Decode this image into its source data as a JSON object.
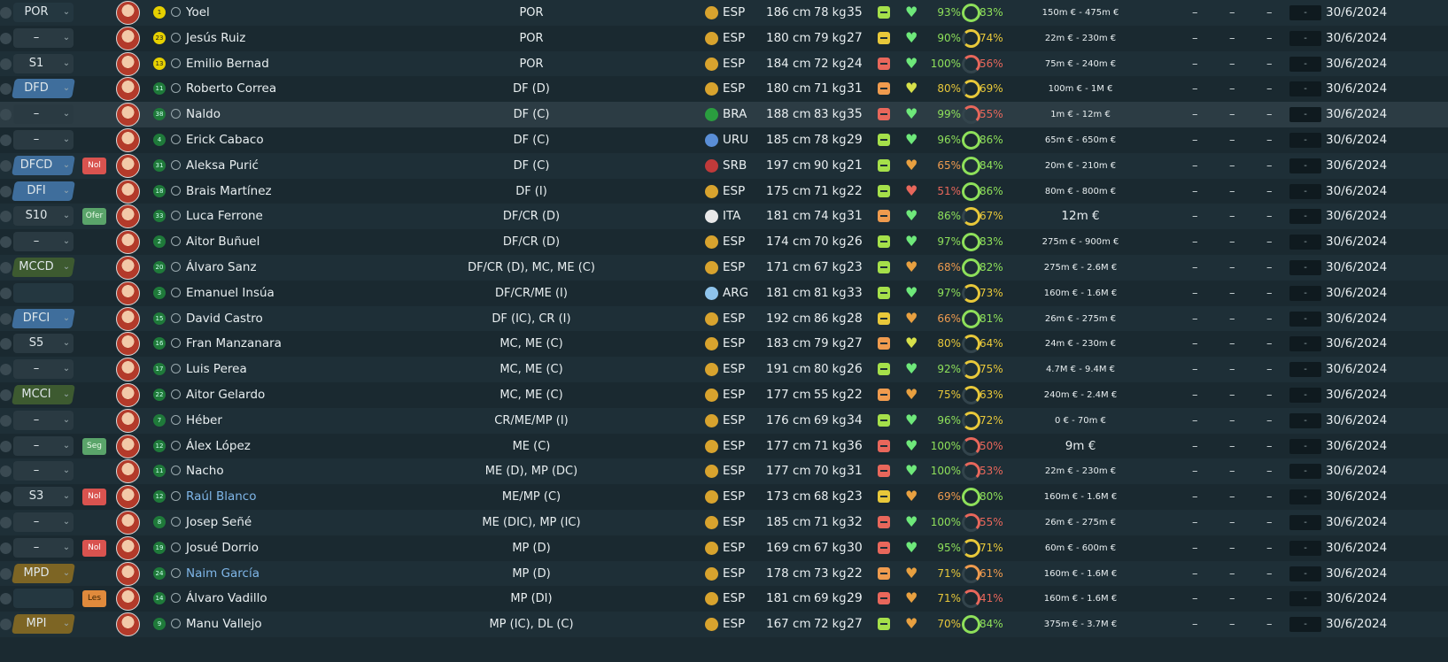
{
  "players": [
    {
      "pos": "POR",
      "posStyle": "none",
      "tag": "",
      "name": "Yoel",
      "link": false,
      "number": "1",
      "gk": true,
      "position": "POR",
      "nation": "ESP",
      "height": "186 cm",
      "weight": "78 kg",
      "age": "35",
      "cond": "green",
      "heart": "green",
      "fitness": "93%",
      "sharp": "83%",
      "sharpClass": "g",
      "value": "150m € - 475m €",
      "bigValue": false,
      "d1": "–",
      "d2": "–",
      "d3": "–",
      "btn": "-",
      "date": "30/6/2024"
    },
    {
      "pos": "–",
      "posStyle": "grey",
      "tag": "",
      "name": "Jesús Ruiz",
      "link": false,
      "number": "23",
      "gk": true,
      "position": "POR",
      "nation": "ESP",
      "height": "180 cm",
      "weight": "79 kg",
      "age": "27",
      "cond": "yellow",
      "heart": "green",
      "fitness": "90%",
      "sharp": "74%",
      "sharpClass": "y",
      "value": "22m € - 230m €",
      "bigValue": false,
      "d1": "–",
      "d2": "–",
      "d3": "–",
      "btn": "-",
      "date": "30/6/2024"
    },
    {
      "pos": "S1",
      "posStyle": "grey",
      "tag": "",
      "name": "Emilio Bernad",
      "link": false,
      "number": "13",
      "gk": true,
      "position": "POR",
      "nation": "ESP",
      "height": "184 cm",
      "weight": "72 kg",
      "age": "24",
      "cond": "red",
      "heart": "green",
      "fitness": "100%",
      "sharp": "56%",
      "sharpClass": "r",
      "value": "75m € - 240m €",
      "bigValue": false,
      "d1": "–",
      "d2": "–",
      "d3": "–",
      "btn": "-",
      "date": "30/6/2024"
    },
    {
      "pos": "DFD",
      "posStyle": "blue",
      "tag": "",
      "name": "Roberto Correa",
      "link": false,
      "number": "11",
      "gk": false,
      "position": "DF (D)",
      "nation": "ESP",
      "height": "180 cm",
      "weight": "71 kg",
      "age": "31",
      "cond": "orange",
      "heart": "yellow",
      "fitness": "80%",
      "sharp": "69%",
      "sharpClass": "y",
      "value": "100m € - 1M €",
      "bigValue": false,
      "d1": "–",
      "d2": "–",
      "d3": "–",
      "btn": "-",
      "date": "30/6/2024"
    },
    {
      "pos": "–",
      "posStyle": "grey",
      "tag": "",
      "name": "Naldo",
      "link": false,
      "number": "38",
      "gk": false,
      "position": "DF (C)",
      "nation": "BRA",
      "height": "188 cm",
      "weight": "83 kg",
      "age": "35",
      "cond": "red",
      "heart": "green",
      "fitness": "99%",
      "sharp": "55%",
      "sharpClass": "r",
      "value": "1m € - 12m €",
      "bigValue": false,
      "d1": "–",
      "d2": "–",
      "d3": "–",
      "btn": "-",
      "date": "30/6/2024",
      "selected": true
    },
    {
      "pos": "–",
      "posStyle": "grey",
      "tag": "",
      "name": "Erick Cabaco",
      "link": false,
      "number": "4",
      "gk": false,
      "position": "DF (C)",
      "nation": "URU",
      "height": "185 cm",
      "weight": "78 kg",
      "age": "29",
      "cond": "green",
      "heart": "green",
      "fitness": "96%",
      "sharp": "86%",
      "sharpClass": "g",
      "value": "65m € - 650m €",
      "bigValue": false,
      "d1": "–",
      "d2": "–",
      "d3": "–",
      "btn": "-",
      "date": "30/6/2024"
    },
    {
      "pos": "DFCD",
      "posStyle": "blue",
      "tag": "Nol",
      "tagStyle": "red",
      "name": "Aleksa Purić",
      "link": false,
      "number": "31",
      "gk": false,
      "position": "DF (C)",
      "nation": "SRB",
      "height": "197 cm",
      "weight": "90 kg",
      "age": "21",
      "cond": "green",
      "heart": "orange",
      "fitness": "65%",
      "sharp": "84%",
      "sharpClass": "g",
      "value": "20m € - 210m €",
      "bigValue": false,
      "d1": "–",
      "d2": "–",
      "d3": "–",
      "btn": "-",
      "date": "30/6/2024"
    },
    {
      "pos": "DFI",
      "posStyle": "blue",
      "tag": "",
      "name": "Brais Martínez",
      "link": false,
      "number": "18",
      "gk": false,
      "position": "DF (I)",
      "nation": "ESP",
      "height": "175 cm",
      "weight": "71 kg",
      "age": "22",
      "cond": "green",
      "heart": "red",
      "fitness": "51%",
      "sharp": "86%",
      "sharpClass": "g",
      "value": "80m € - 800m €",
      "bigValue": false,
      "d1": "–",
      "d2": "–",
      "d3": "–",
      "btn": "-",
      "date": "30/6/2024"
    },
    {
      "pos": "S10",
      "posStyle": "grey",
      "tag": "Ofer",
      "tagStyle": "green",
      "name": "Luca Ferrone",
      "link": false,
      "number": "33",
      "gk": false,
      "position": "DF/CR (D)",
      "nation": "ITA",
      "height": "181 cm",
      "weight": "74 kg",
      "age": "31",
      "cond": "orange",
      "heart": "green",
      "fitness": "86%",
      "sharp": "67%",
      "sharpClass": "y",
      "value": "12m €",
      "bigValue": true,
      "d1": "–",
      "d2": "–",
      "d3": "–",
      "btn": "-",
      "date": "30/6/2024"
    },
    {
      "pos": "–",
      "posStyle": "grey",
      "tag": "",
      "name": "Aitor Buñuel",
      "link": false,
      "number": "2",
      "gk": false,
      "position": "DF/CR (D)",
      "nation": "ESP",
      "height": "174 cm",
      "weight": "70 kg",
      "age": "26",
      "cond": "green",
      "heart": "green",
      "fitness": "97%",
      "sharp": "83%",
      "sharpClass": "g",
      "value": "275m € - 900m €",
      "bigValue": false,
      "d1": "–",
      "d2": "–",
      "d3": "–",
      "btn": "-",
      "date": "30/6/2024"
    },
    {
      "pos": "MCCD",
      "posStyle": "green",
      "tag": "",
      "name": "Álvaro Sanz",
      "link": false,
      "number": "20",
      "gk": false,
      "position": "DF/CR (D), MC, ME (C)",
      "nation": "ESP",
      "height": "171 cm",
      "weight": "67 kg",
      "age": "23",
      "cond": "green",
      "heart": "orange",
      "fitness": "68%",
      "sharp": "82%",
      "sharpClass": "g",
      "value": "275m € - 2.6M €",
      "bigValue": false,
      "d1": "–",
      "d2": "–",
      "d3": "–",
      "btn": "-",
      "date": "30/6/2024"
    },
    {
      "pos": "",
      "posStyle": "none",
      "tag": "",
      "name": "Emanuel Insúa",
      "link": false,
      "number": "3",
      "gk": false,
      "position": "DF/CR/ME (I)",
      "nation": "ARG",
      "height": "181 cm",
      "weight": "81 kg",
      "age": "33",
      "cond": "green",
      "heart": "green",
      "fitness": "97%",
      "sharp": "73%",
      "sharpClass": "y",
      "value": "160m € - 1.6M €",
      "bigValue": false,
      "d1": "–",
      "d2": "–",
      "d3": "–",
      "btn": "-",
      "date": "30/6/2024"
    },
    {
      "pos": "DFCI",
      "posStyle": "blue",
      "tag": "",
      "name": "David Castro",
      "link": false,
      "number": "15",
      "gk": false,
      "position": "DF (IC), CR (I)",
      "nation": "ESP",
      "height": "192 cm",
      "weight": "86 kg",
      "age": "28",
      "cond": "yellow",
      "heart": "orange",
      "fitness": "66%",
      "sharp": "81%",
      "sharpClass": "g",
      "value": "26m € - 275m €",
      "bigValue": false,
      "d1": "–",
      "d2": "–",
      "d3": "–",
      "btn": "-",
      "date": "30/6/2024"
    },
    {
      "pos": "S5",
      "posStyle": "grey",
      "tag": "",
      "name": "Fran Manzanara",
      "link": false,
      "number": "16",
      "gk": false,
      "position": "MC, ME (C)",
      "nation": "ESP",
      "height": "183 cm",
      "weight": "79 kg",
      "age": "27",
      "cond": "orange",
      "heart": "yellow",
      "fitness": "80%",
      "sharp": "64%",
      "sharpClass": "y",
      "value": "24m € - 230m €",
      "bigValue": false,
      "d1": "–",
      "d2": "–",
      "d3": "–",
      "btn": "-",
      "date": "30/6/2024"
    },
    {
      "pos": "–",
      "posStyle": "grey",
      "tag": "",
      "name": "Luis Perea",
      "link": false,
      "number": "17",
      "gk": false,
      "position": "MC, ME (C)",
      "nation": "ESP",
      "height": "191 cm",
      "weight": "80 kg",
      "age": "26",
      "cond": "green",
      "heart": "green",
      "fitness": "92%",
      "sharp": "75%",
      "sharpClass": "y",
      "value": "4.7M € - 9.4M €",
      "bigValue": false,
      "d1": "–",
      "d2": "–",
      "d3": "–",
      "btn": "-",
      "date": "30/6/2024"
    },
    {
      "pos": "MCCI",
      "posStyle": "green",
      "tag": "",
      "name": "Aitor Gelardo",
      "link": false,
      "number": "22",
      "gk": false,
      "position": "MC, ME (C)",
      "nation": "ESP",
      "height": "177 cm",
      "weight": "55 kg",
      "age": "22",
      "cond": "orange",
      "heart": "orange",
      "fitness": "75%",
      "sharp": "63%",
      "sharpClass": "y",
      "value": "240m € - 2.4M €",
      "bigValue": false,
      "d1": "–",
      "d2": "–",
      "d3": "–",
      "btn": "-",
      "date": "30/6/2024"
    },
    {
      "pos": "–",
      "posStyle": "grey",
      "tag": "",
      "name": "Héber",
      "link": false,
      "number": "7",
      "gk": false,
      "position": "CR/ME/MP (I)",
      "nation": "ESP",
      "height": "176 cm",
      "weight": "69 kg",
      "age": "34",
      "cond": "green",
      "heart": "green",
      "fitness": "96%",
      "sharp": "72%",
      "sharpClass": "y",
      "value": "0 € - 70m €",
      "bigValue": false,
      "d1": "–",
      "d2": "–",
      "d3": "–",
      "btn": "-",
      "date": "30/6/2024"
    },
    {
      "pos": "–",
      "posStyle": "grey",
      "tag": "Seg",
      "tagStyle": "green",
      "name": "Álex López",
      "link": false,
      "number": "12",
      "gk": false,
      "position": "ME (C)",
      "nation": "ESP",
      "height": "177 cm",
      "weight": "71 kg",
      "age": "36",
      "cond": "red",
      "heart": "green",
      "fitness": "100%",
      "sharp": "50%",
      "sharpClass": "r",
      "value": "9m €",
      "bigValue": true,
      "d1": "–",
      "d2": "–",
      "d3": "–",
      "btn": "-",
      "date": "30/6/2024"
    },
    {
      "pos": "–",
      "posStyle": "grey",
      "tag": "",
      "name": "Nacho",
      "link": false,
      "number": "11",
      "gk": false,
      "position": "ME (D), MP (DC)",
      "nation": "ESP",
      "height": "177 cm",
      "weight": "70 kg",
      "age": "31",
      "cond": "red",
      "heart": "green",
      "fitness": "100%",
      "sharp": "53%",
      "sharpClass": "r",
      "value": "22m € - 230m €",
      "bigValue": false,
      "d1": "–",
      "d2": "–",
      "d3": "–",
      "btn": "-",
      "date": "30/6/2024"
    },
    {
      "pos": "S3",
      "posStyle": "grey",
      "tag": "Nol",
      "tagStyle": "red",
      "name": "Raúl Blanco",
      "link": true,
      "number": "12",
      "gk": false,
      "position": "ME/MP (C)",
      "nation": "ESP",
      "height": "173 cm",
      "weight": "68 kg",
      "age": "23",
      "cond": "yellow",
      "heart": "orange",
      "fitness": "69%",
      "sharp": "80%",
      "sharpClass": "g",
      "value": "160m € - 1.6M €",
      "bigValue": false,
      "d1": "–",
      "d2": "–",
      "d3": "–",
      "btn": "-",
      "date": "30/6/2024"
    },
    {
      "pos": "–",
      "posStyle": "grey",
      "tag": "",
      "name": "Josep Señé",
      "link": false,
      "number": "8",
      "gk": false,
      "position": "ME (DIC), MP (IC)",
      "nation": "ESP",
      "height": "185 cm",
      "weight": "71 kg",
      "age": "32",
      "cond": "red",
      "heart": "green",
      "fitness": "100%",
      "sharp": "55%",
      "sharpClass": "r",
      "value": "26m € - 275m €",
      "bigValue": false,
      "d1": "–",
      "d2": "–",
      "d3": "–",
      "btn": "-",
      "date": "30/6/2024"
    },
    {
      "pos": "–",
      "posStyle": "grey",
      "tag": "Nol",
      "tagStyle": "red",
      "name": "Josué Dorrio",
      "link": false,
      "number": "19",
      "gk": false,
      "position": "MP (D)",
      "nation": "ESP",
      "height": "169 cm",
      "weight": "67 kg",
      "age": "30",
      "cond": "red",
      "heart": "green",
      "fitness": "95%",
      "sharp": "71%",
      "sharpClass": "y",
      "value": "60m € - 600m €",
      "bigValue": false,
      "d1": "–",
      "d2": "–",
      "d3": "–",
      "btn": "-",
      "date": "30/6/2024"
    },
    {
      "pos": "MPD",
      "posStyle": "gold",
      "tag": "",
      "name": "Naim García",
      "link": true,
      "number": "24",
      "gk": false,
      "position": "MP (D)",
      "nation": "ESP",
      "height": "178 cm",
      "weight": "73 kg",
      "age": "22",
      "cond": "orange",
      "heart": "orange",
      "fitness": "71%",
      "sharp": "61%",
      "sharpClass": "o",
      "value": "160m € - 1.6M €",
      "bigValue": false,
      "d1": "–",
      "d2": "–",
      "d3": "–",
      "btn": "-",
      "date": "30/6/2024"
    },
    {
      "pos": "",
      "posStyle": "none",
      "tag": "Les",
      "tagStyle": "orange",
      "name": "Álvaro Vadillo",
      "link": false,
      "number": "14",
      "gk": false,
      "position": "MP (DI)",
      "nation": "ESP",
      "height": "181 cm",
      "weight": "69 kg",
      "age": "29",
      "cond": "red",
      "heart": "orange",
      "fitness": "71%",
      "sharp": "41%",
      "sharpClass": "r",
      "value": "160m € - 1.6M €",
      "bigValue": false,
      "d1": "–",
      "d2": "–",
      "d3": "–",
      "btn": "-",
      "date": "30/6/2024"
    },
    {
      "pos": "MPI",
      "posStyle": "gold",
      "tag": "",
      "name": "Manu Vallejo",
      "link": false,
      "number": "9",
      "gk": false,
      "position": "MP (IC), DL (C)",
      "nation": "ESP",
      "height": "167 cm",
      "weight": "72 kg",
      "age": "27",
      "cond": "green",
      "heart": "orange",
      "fitness": "70%",
      "sharp": "84%",
      "sharpClass": "g",
      "value": "375m € - 3.7M €",
      "bigValue": false,
      "d1": "–",
      "d2": "–",
      "d3": "–",
      "btn": "-",
      "date": "30/6/2024"
    }
  ],
  "colors": {
    "heart_green": "#6ee87a",
    "heart_yellow": "#d6e04a",
    "heart_orange": "#e8a040",
    "heart_red": "#e8675b",
    "ring_g": "#8ee05a",
    "ring_y": "#e8c83a",
    "ring_o": "#ef9b4e",
    "ring_r": "#e8675b",
    "flag_ESP": "#d8a32e",
    "flag_BRA": "#2a9d3f",
    "flag_URU": "#5a8ed6",
    "flag_SRB": "#c03a3a",
    "flag_ITA": "#e9e9e9",
    "flag_ARG": "#8fc4ec"
  },
  "icons": {
    "chevron": "chevron-down-icon",
    "heart": "heart-icon",
    "pin": "person-icon"
  }
}
